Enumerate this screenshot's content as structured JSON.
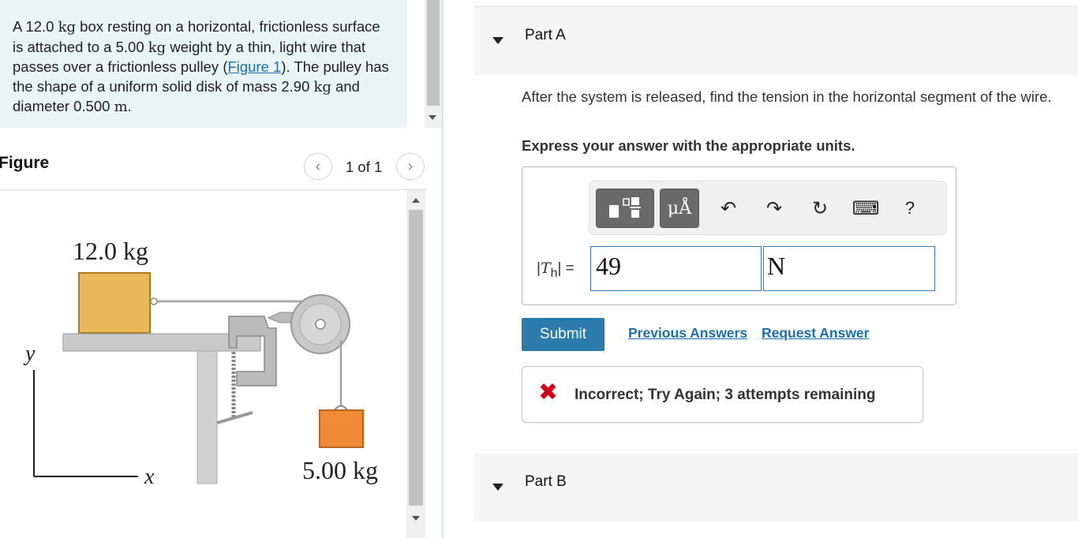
{
  "problem": {
    "text_1": "A 12.0 ",
    "kg": "kg",
    "text_2": " box resting on a horizontal, frictionless surface is attached to a 5.00 ",
    "text_3": " weight by a thin, light wire that passes over a frictionless pulley (",
    "figure_link": "Figure 1",
    "text_4": "). The pulley has the shape of a uniform solid disk of mass 2.90 ",
    "text_5": " and diameter 0.500 ",
    "m": "m",
    "text_6": "."
  },
  "figure": {
    "title": "Figure",
    "count": "1 of 1",
    "box_mass": "12.0 kg",
    "weight_mass": "5.00 kg",
    "axis_y": "y",
    "axis_x": "x",
    "colors": {
      "box": "#e8b85a",
      "weight": "#ef8a36",
      "table": "#c9c9c9"
    }
  },
  "partA": {
    "label": "Part A",
    "question": "After the system is released, find the tension in the horizontal segment of the wire.",
    "express": "Express your answer with the appropriate units.",
    "var_bars_open": "|",
    "var_T": "T",
    "var_sub": "h",
    "var_bars_close": "| =",
    "value": "49",
    "unit": "N",
    "toolbar": {
      "templates_icon": "templates-icon",
      "units_label": "μÅ",
      "undo": "↶",
      "redo": "↷",
      "reset": "↻",
      "keyboard": "⌨",
      "help": "?"
    },
    "submit": "Submit",
    "previous_answers": "Previous Answers",
    "request_answer": "Request Answer",
    "feedback_icon": "✖",
    "feedback": "Incorrect; Try Again; 3 attempts remaining"
  },
  "partB": {
    "label": "Part B"
  },
  "colors": {
    "accent": "#2b7bab",
    "link": "#1a6fb0",
    "error": "#d3001c",
    "problem_bg": "#e9f5f5"
  }
}
